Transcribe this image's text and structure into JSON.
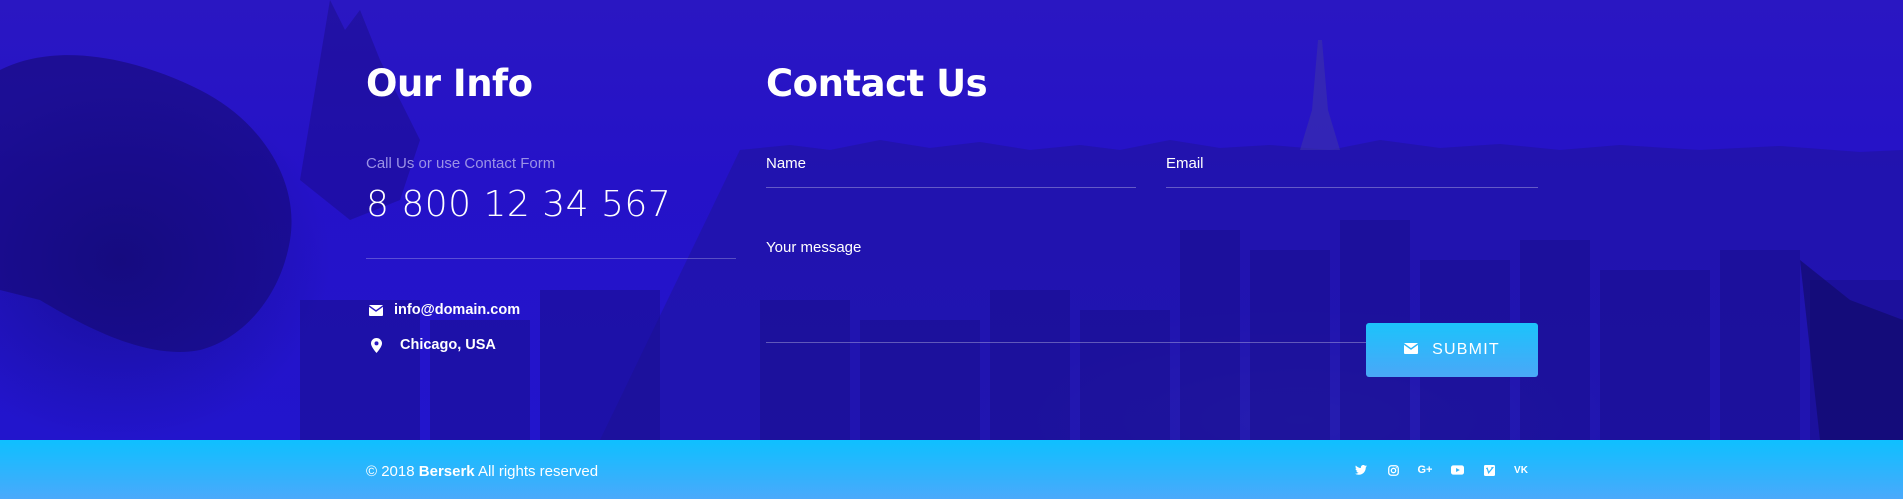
{
  "info": {
    "title": "Our Info",
    "call_label": "Call Us or use Contact Form",
    "phone": "8 800 12 34 567",
    "email": "info@domain.com",
    "location": "Chicago, USA",
    "email_icon": "envelope-icon",
    "location_icon": "map-pin-icon"
  },
  "contact": {
    "title": "Contact Us",
    "name_label": "Name",
    "email_label": "Email",
    "message_label": "Your message",
    "submit_label": "SUBMIT",
    "submit_icon": "envelope-icon"
  },
  "footer": {
    "copyright_prefix": "© 2018",
    "brand": "Berserk",
    "copyright_suffix": "All rights reserved",
    "social": [
      {
        "name": "twitter-icon",
        "glyph": "🐦"
      },
      {
        "name": "instagram-icon",
        "glyph": "◎"
      },
      {
        "name": "google-plus-icon",
        "glyph": "G+"
      },
      {
        "name": "youtube-icon",
        "glyph": "▶"
      },
      {
        "name": "vimeo-icon",
        "glyph": "V"
      },
      {
        "name": "vk-icon",
        "glyph": "VK"
      }
    ]
  },
  "colors": {
    "hero_bg": "#2a17c2",
    "footer_bg": "#0ec0ff",
    "button_bg": "#1cc3fb",
    "muted_text": "#9b92e6"
  }
}
